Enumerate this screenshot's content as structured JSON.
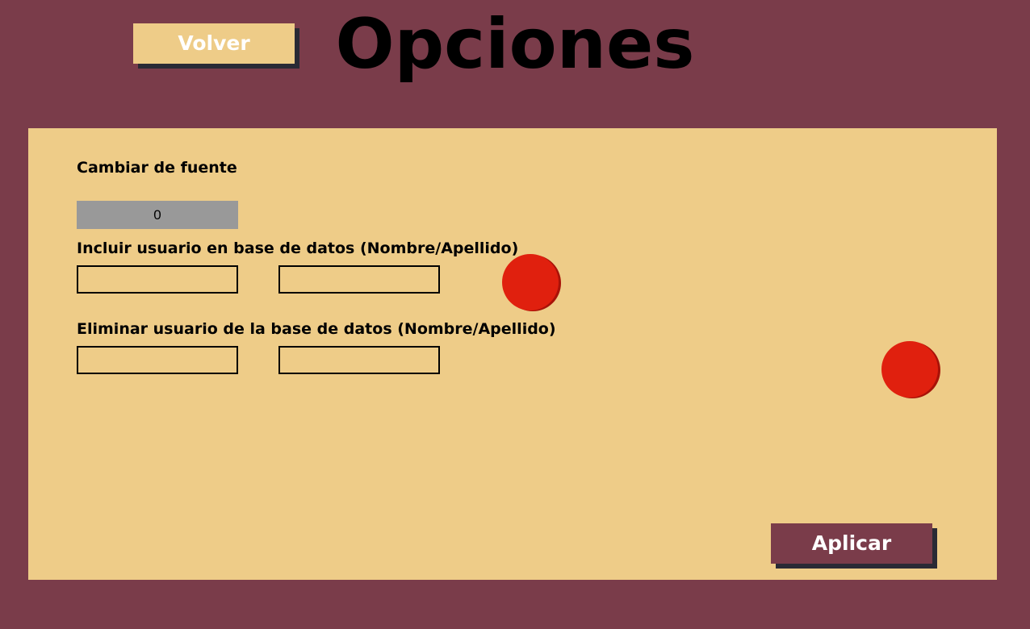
{
  "header": {
    "back_label": "Volver",
    "title": "Opciones"
  },
  "options": {
    "font_label": "Cambiar de fuente",
    "font_value": "0",
    "include_label": "Incluir usuario en base de datos (Nombre/Apellido)",
    "include_first_name": "",
    "include_last_name": "",
    "delete_label": "Eliminar usuario de la base de datos (Nombre/Apellido)",
    "delete_first_name": "",
    "delete_last_name": "",
    "apply_label": "Aplicar"
  },
  "colors": {
    "background": "#7a3c4a",
    "panel": "#eecc88",
    "action_red": "#e0200e",
    "shadow": "#2a2a35"
  }
}
